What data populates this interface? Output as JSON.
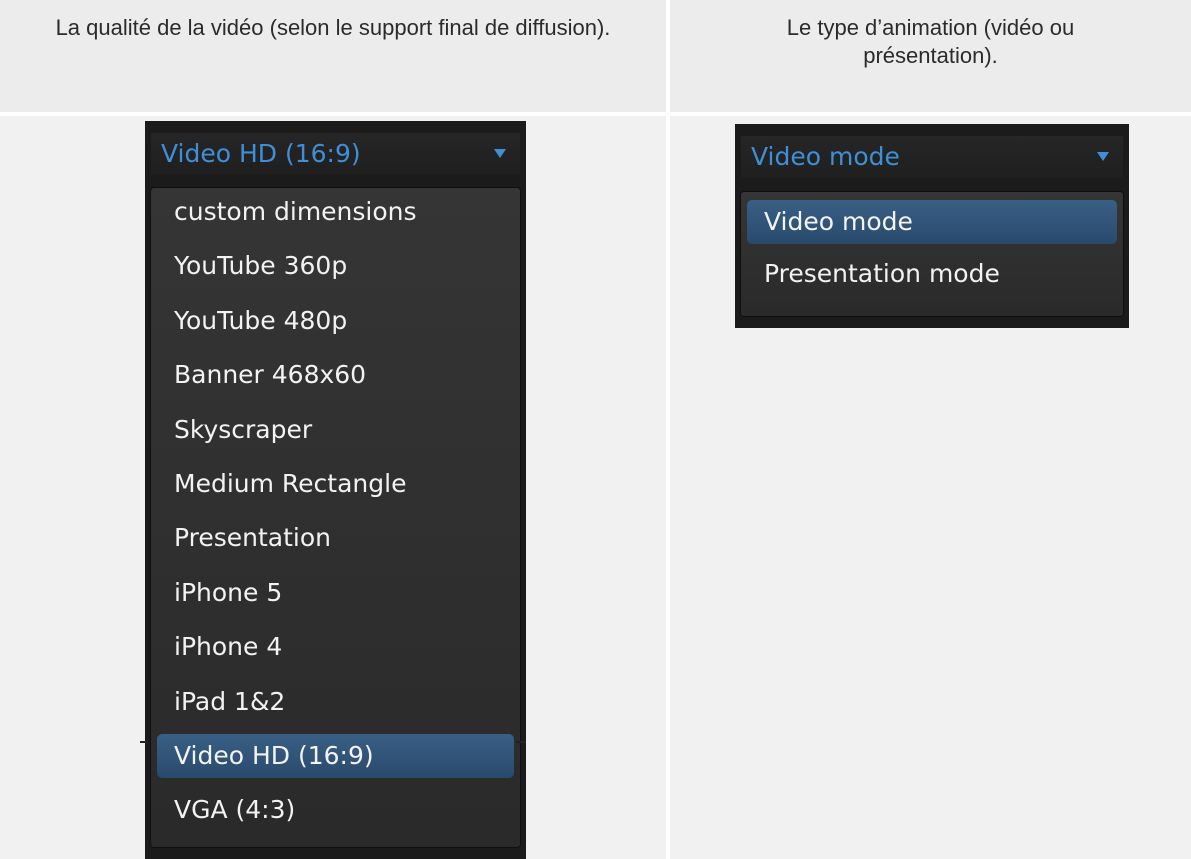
{
  "headers": {
    "quality": "La qualité de la vidéo (selon le support final de diffusion).",
    "mode": "Le type d’animation (vidéo ou présentation)."
  },
  "quality_select": {
    "value": "Video HD (16:9)",
    "options": [
      {
        "label": "custom dimensions",
        "selected": false
      },
      {
        "label": "YouTube 360p",
        "selected": false
      },
      {
        "label": "YouTube 480p",
        "selected": false
      },
      {
        "label": "Banner 468x60",
        "selected": false
      },
      {
        "label": "Skyscraper",
        "selected": false
      },
      {
        "label": "Medium Rectangle",
        "selected": false
      },
      {
        "label": "Presentation",
        "selected": false
      },
      {
        "label": "iPhone 5",
        "selected": false
      },
      {
        "label": "iPhone 4",
        "selected": false
      },
      {
        "label": "iPad 1&2",
        "selected": false
      },
      {
        "label": "Video HD (16:9)",
        "selected": true
      },
      {
        "label": "VGA (4:3)",
        "selected": false
      }
    ]
  },
  "mode_select": {
    "value": "Video mode",
    "options": [
      {
        "label": "Video mode",
        "selected": true
      },
      {
        "label": "Presentation mode",
        "selected": false
      }
    ]
  },
  "colors": {
    "accent": "#3f8fd6",
    "selected_row": "#2f5479",
    "panel_bg": "#1b1b1b",
    "cell_bg": "#f1f1f1"
  },
  "icons": {
    "dropdown_arrow": "chevron-down-icon"
  }
}
